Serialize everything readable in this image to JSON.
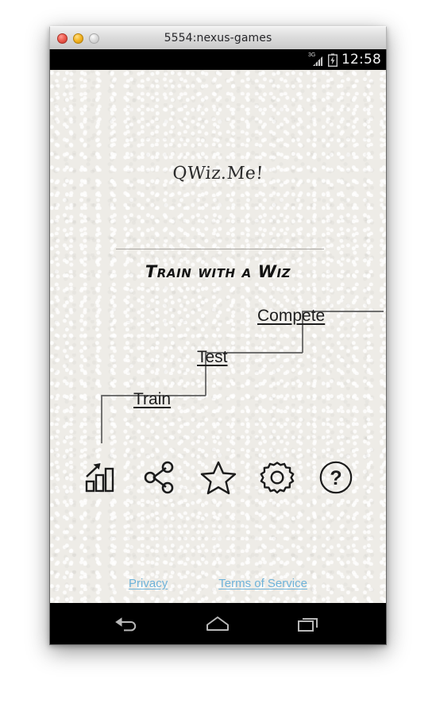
{
  "window": {
    "title": "5554:nexus-games",
    "controls": [
      {
        "name": "close",
        "color": "#ef5f52"
      },
      {
        "name": "minimize",
        "color": "#f6b828"
      },
      {
        "name": "maximize",
        "color": "#dcdcdc"
      }
    ]
  },
  "status_bar": {
    "network_label": "3G",
    "signal_icon": "signal-bars-icon",
    "battery_icon": "battery-charging-icon",
    "clock": "12:58"
  },
  "app": {
    "logo": "QWiz.Me!",
    "tagline": "Train with a Wiz",
    "background_color": "#eeece7",
    "text_color": "#1d1d1d"
  },
  "staircase": {
    "steps": [
      {
        "label": "Train",
        "level": 1
      },
      {
        "label": "Test",
        "level": 2
      },
      {
        "label": "Compete",
        "level": 3
      }
    ],
    "line_color": "#5c5c5c"
  },
  "icons": [
    {
      "name": "stats-chart-icon",
      "label": "Stats"
    },
    {
      "name": "share-icon",
      "label": "Share"
    },
    {
      "name": "star-icon",
      "label": "Favorites"
    },
    {
      "name": "gear-icon",
      "label": "Settings"
    },
    {
      "name": "help-icon",
      "label": "Help"
    }
  ],
  "footer": {
    "links": [
      {
        "label": "Privacy"
      },
      {
        "label": "Terms of Service"
      }
    ],
    "link_color": "#6fb3d9"
  },
  "nav_bar": {
    "buttons": [
      {
        "name": "back-button",
        "icon": "back-arrow-icon"
      },
      {
        "name": "home-button",
        "icon": "home-icon"
      },
      {
        "name": "recents-button",
        "icon": "recents-icon"
      }
    ],
    "icon_color": "#b8b8b8"
  }
}
